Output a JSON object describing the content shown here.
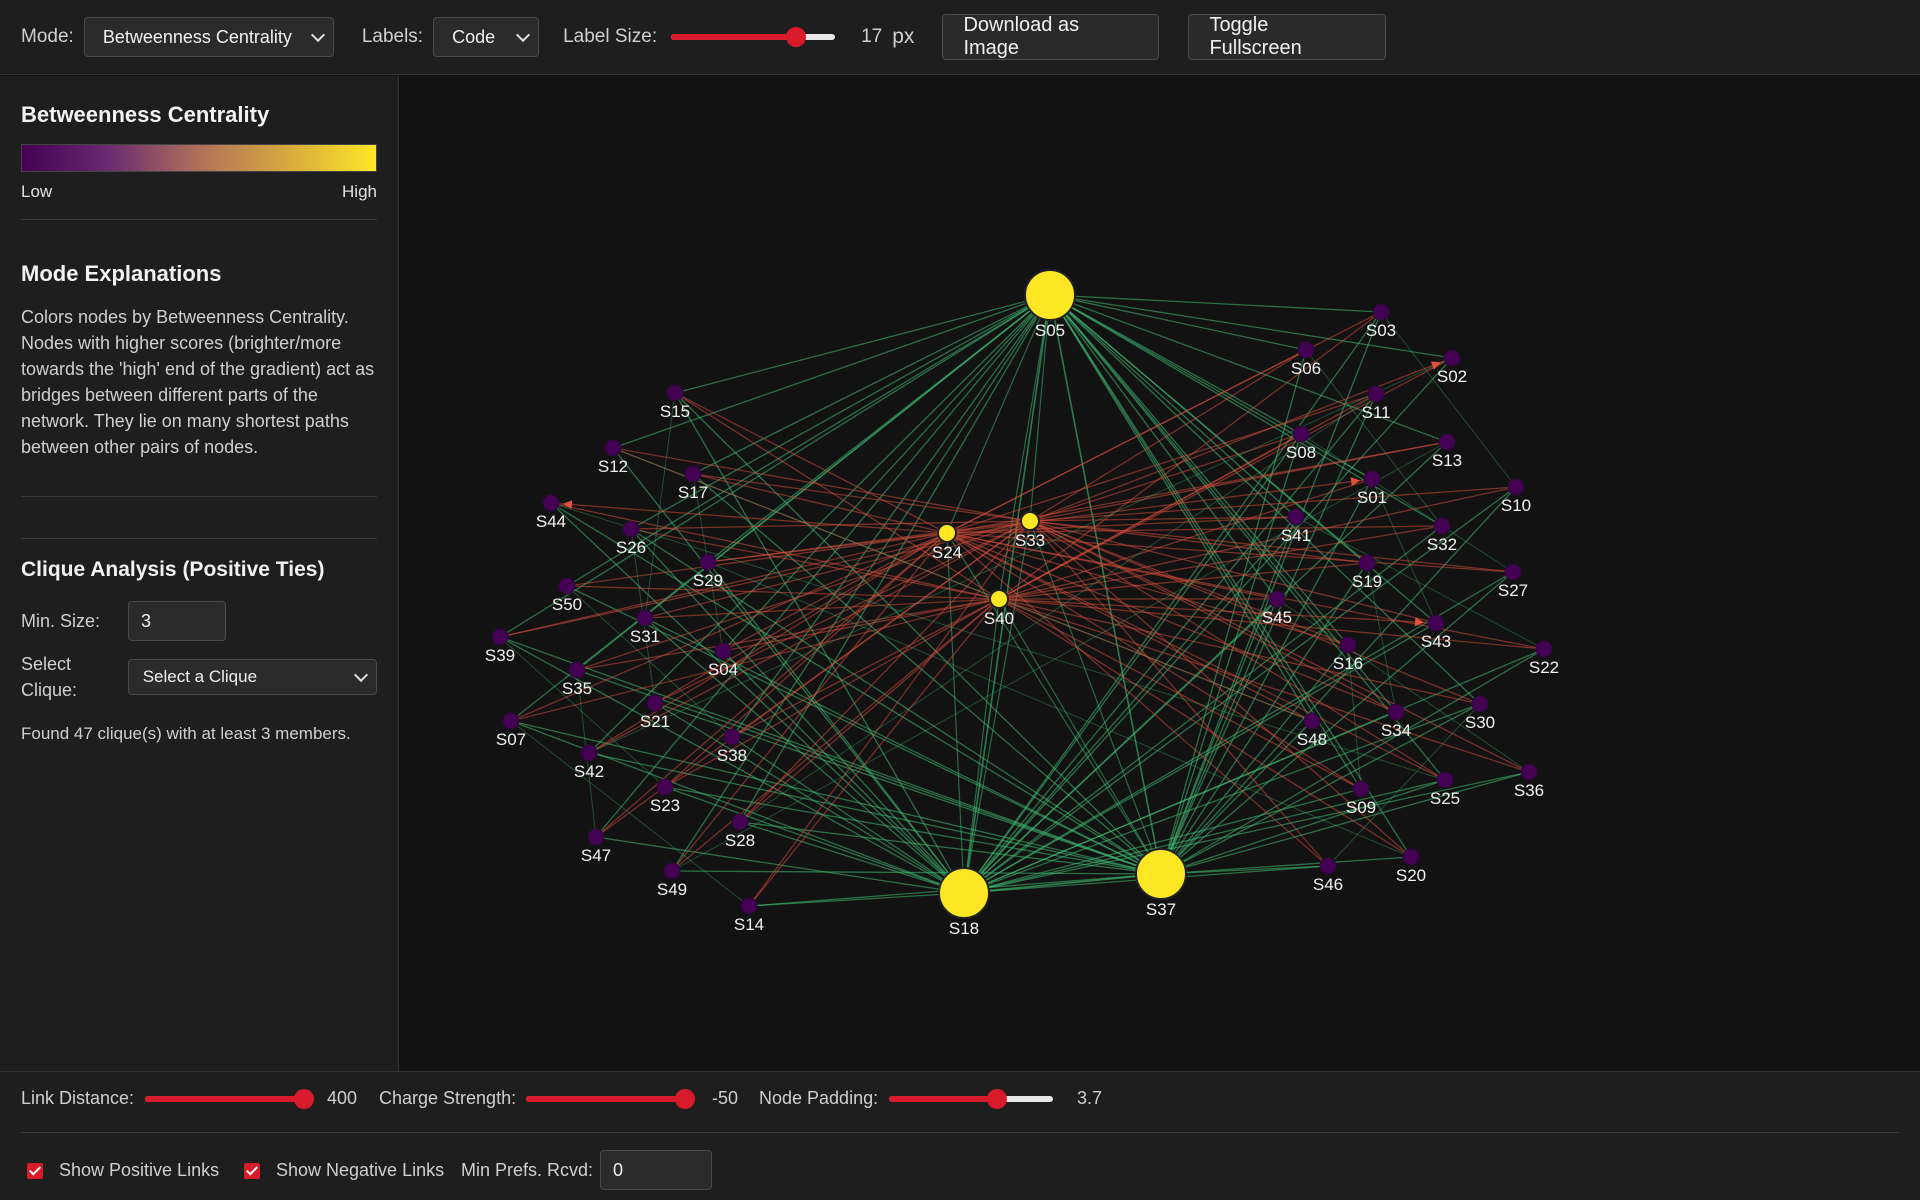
{
  "toolbar": {
    "mode_label": "Mode:",
    "mode_value": "Betweenness Centrality",
    "labels_label": "Labels:",
    "labels_value": "Code",
    "label_size_label": "Label Size:",
    "label_size_value": "17",
    "label_size_unit": "px",
    "label_size_fraction": 0.76,
    "download_button": "Download as Image",
    "fullscreen_button": "Toggle Fullscreen"
  },
  "sidebar": {
    "legend_title": "Betweenness Centrality",
    "legend_low": "Low",
    "legend_high": "High",
    "explanations_title": "Mode Explanations",
    "explanation_text": "Colors nodes by Betweenness Centrality. Nodes with higher scores (brighter/more towards the 'high' end of the gradient) act as bridges between different parts of the network. They lie on many shortest paths between other pairs of nodes.",
    "clique_title": "Clique Analysis (Positive Ties)",
    "min_size_label": "Min. Size:",
    "min_size_value": "3",
    "select_clique_label": "Select Clique:",
    "select_clique_value": "Select a Clique",
    "clique_result": "Found 47 clique(s) with at least 3 members."
  },
  "bottom": {
    "link_distance_label": "Link Distance:",
    "link_distance_value": "400",
    "link_distance_fraction": 0.97,
    "charge_label": "Charge Strength:",
    "charge_value": "-50",
    "charge_fraction": 0.97,
    "padding_label": "Node Padding:",
    "padding_value": "3.7",
    "padding_fraction": 0.66,
    "show_positive": "Show Positive Links",
    "show_negative": "Show Negative Links",
    "min_prefs_label": "Min Prefs. Rcvd:",
    "min_prefs_value": "0"
  },
  "colors": {
    "positive_link": "#3fbf73",
    "negative_link": "#e0503c",
    "node_low": "#440154",
    "node_high": "#fde725",
    "accent": "#d81b2a"
  },
  "graph": {
    "nodes": [
      {
        "id": "S05",
        "centrality": "high"
      },
      {
        "id": "S18",
        "centrality": "high"
      },
      {
        "id": "S37",
        "centrality": "high"
      },
      {
        "id": "S24",
        "centrality": "high"
      },
      {
        "id": "S33",
        "centrality": "high"
      },
      {
        "id": "S40",
        "centrality": "high"
      },
      {
        "id": "S03",
        "centrality": "low"
      },
      {
        "id": "S02",
        "centrality": "low"
      },
      {
        "id": "S06",
        "centrality": "low"
      },
      {
        "id": "S11",
        "centrality": "low"
      },
      {
        "id": "S08",
        "centrality": "low"
      },
      {
        "id": "S13",
        "centrality": "low"
      },
      {
        "id": "S01",
        "centrality": "low"
      },
      {
        "id": "S10",
        "centrality": "low"
      },
      {
        "id": "S41",
        "centrality": "low"
      },
      {
        "id": "S32",
        "centrality": "low"
      },
      {
        "id": "S19",
        "centrality": "low"
      },
      {
        "id": "S27",
        "centrality": "low"
      },
      {
        "id": "S45",
        "centrality": "low"
      },
      {
        "id": "S43",
        "centrality": "low"
      },
      {
        "id": "S16",
        "centrality": "low"
      },
      {
        "id": "S22",
        "centrality": "low"
      },
      {
        "id": "S30",
        "centrality": "low"
      },
      {
        "id": "S34",
        "centrality": "low"
      },
      {
        "id": "S48",
        "centrality": "low"
      },
      {
        "id": "S36",
        "centrality": "low"
      },
      {
        "id": "S25",
        "centrality": "low"
      },
      {
        "id": "S09",
        "centrality": "low"
      },
      {
        "id": "S20",
        "centrality": "low"
      },
      {
        "id": "S46",
        "centrality": "low"
      },
      {
        "id": "S15",
        "centrality": "low"
      },
      {
        "id": "S12",
        "centrality": "low"
      },
      {
        "id": "S17",
        "centrality": "low"
      },
      {
        "id": "S44",
        "centrality": "low"
      },
      {
        "id": "S26",
        "centrality": "low"
      },
      {
        "id": "S29",
        "centrality": "low"
      },
      {
        "id": "S50",
        "centrality": "low"
      },
      {
        "id": "S31",
        "centrality": "low"
      },
      {
        "id": "S39",
        "centrality": "low"
      },
      {
        "id": "S04",
        "centrality": "low"
      },
      {
        "id": "S35",
        "centrality": "low"
      },
      {
        "id": "S21",
        "centrality": "low"
      },
      {
        "id": "S07",
        "centrality": "low"
      },
      {
        "id": "S38",
        "centrality": "low"
      },
      {
        "id": "S42",
        "centrality": "low"
      },
      {
        "id": "S23",
        "centrality": "low"
      },
      {
        "id": "S28",
        "centrality": "low"
      },
      {
        "id": "S47",
        "centrality": "low"
      },
      {
        "id": "S49",
        "centrality": "low"
      },
      {
        "id": "S14",
        "centrality": "low"
      }
    ]
  }
}
